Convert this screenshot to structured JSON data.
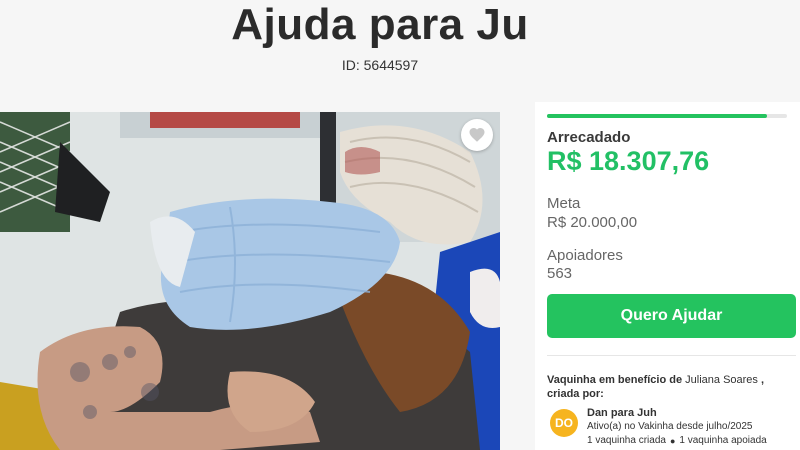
{
  "header": {
    "title": "Ajuda para Ju",
    "id_text": "ID: 5644597"
  },
  "summary": {
    "progress_fraction": 0.915,
    "raised_label": "Arrecadado",
    "raised_value": "R$ 18.307,76",
    "goal_label": "Meta",
    "goal_value": "R$ 20.000,00",
    "supporters_label": "Apoiadores",
    "supporters_value": "563",
    "help_button_label": "Quero Ajudar"
  },
  "organizer": {
    "benefit_prefix": "Vaquinha em benefício de",
    "beneficiary": "Juliana Soares",
    "benefit_suffix": ", criada por:",
    "avatar_initials": "DO",
    "name": "Dan para Juh",
    "active_text": "Ativo(a) no Vakinha desde julho/2025",
    "created_count": "1 vaquinha criada",
    "supported_count": "1 vaquinha apoiada"
  },
  "colors": {
    "accent_green": "#24c35f",
    "raised_green": "#22c065",
    "avatar_orange": "#f6b41f"
  },
  "icons": {
    "favorite": "heart-icon"
  }
}
